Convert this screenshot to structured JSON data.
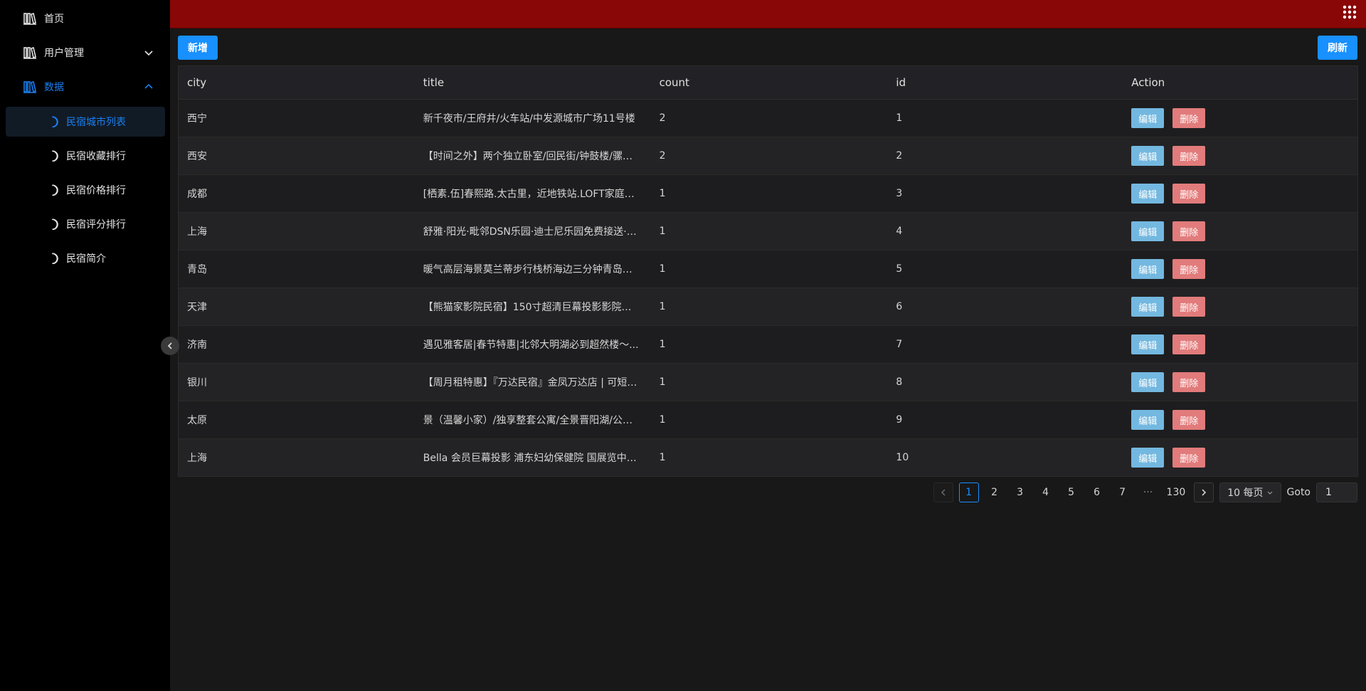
{
  "sidebar": {
    "home": "首页",
    "user_mgmt": "用户管理",
    "data": "数据",
    "sub_items": [
      "民宿城市列表",
      "民宿收藏排行",
      "民宿价格排行",
      "民宿评分排行",
      "民宿简介"
    ],
    "active_index": 0
  },
  "toolbar": {
    "add_label": "新增",
    "refresh_label": "刷新"
  },
  "table": {
    "columns": [
      "city",
      "title",
      "count",
      "id",
      "Action"
    ],
    "rows": [
      {
        "city": "西宁",
        "title": "新千夜市/王府井/火车站/中发源城市广场11号楼",
        "count": "2",
        "id": "1"
      },
      {
        "city": "西安",
        "title": "【时间之外】两个独立卧室/回民街/钟鼓楼/骡马市...",
        "count": "2",
        "id": "2"
      },
      {
        "city": "成都",
        "title": "[栖素.伍]春熙路.太古里，近地铁站.LOFT家庭影院...",
        "count": "1",
        "id": "3"
      },
      {
        "city": "上海",
        "title": "舒雅·阳光·毗邻DSN乐园·迪士尼乐园免费接送·早餐...",
        "count": "1",
        "id": "4"
      },
      {
        "city": "青岛",
        "title": "暖气高层海景莫兰蒂步行栈桥海边三分钟青岛站...",
        "count": "1",
        "id": "5"
      },
      {
        "city": "天津",
        "title": "【熊猫家影院民宿】150寸超清巨幕投影影院房...",
        "count": "1",
        "id": "6"
      },
      {
        "city": "济南",
        "title": "遇见雅客居|春节特惠|北邻大明湖必到超然楼～...",
        "count": "1",
        "id": "7"
      },
      {
        "city": "银川",
        "title": "【周月租特惠】『万达民宿』金凤万达店 | 可短租...",
        "count": "1",
        "id": "8"
      },
      {
        "city": "太原",
        "title": "景（温馨小家）/独享整套公寓/全景晋阳湖/公园...",
        "count": "1",
        "id": "9"
      },
      {
        "city": "上海",
        "title": "Bella 会员巨幕投影 浦东妇幼保健院 国展览中心...",
        "count": "1",
        "id": "10"
      }
    ],
    "edit_label": "编辑",
    "delete_label": "删除"
  },
  "pagination": {
    "pages": [
      "1",
      "2",
      "3",
      "4",
      "5",
      "6",
      "7"
    ],
    "ellipsis": "···",
    "last_page": "130",
    "current": "1",
    "page_size": "10 每页",
    "goto_label": "Goto",
    "goto_value": "1"
  },
  "colors": {
    "topbar": "#8a0707",
    "primary": "#1890ff",
    "edit": "#73b8e0",
    "delete": "#e27b7b",
    "active_menu": "#1a7ff0"
  }
}
